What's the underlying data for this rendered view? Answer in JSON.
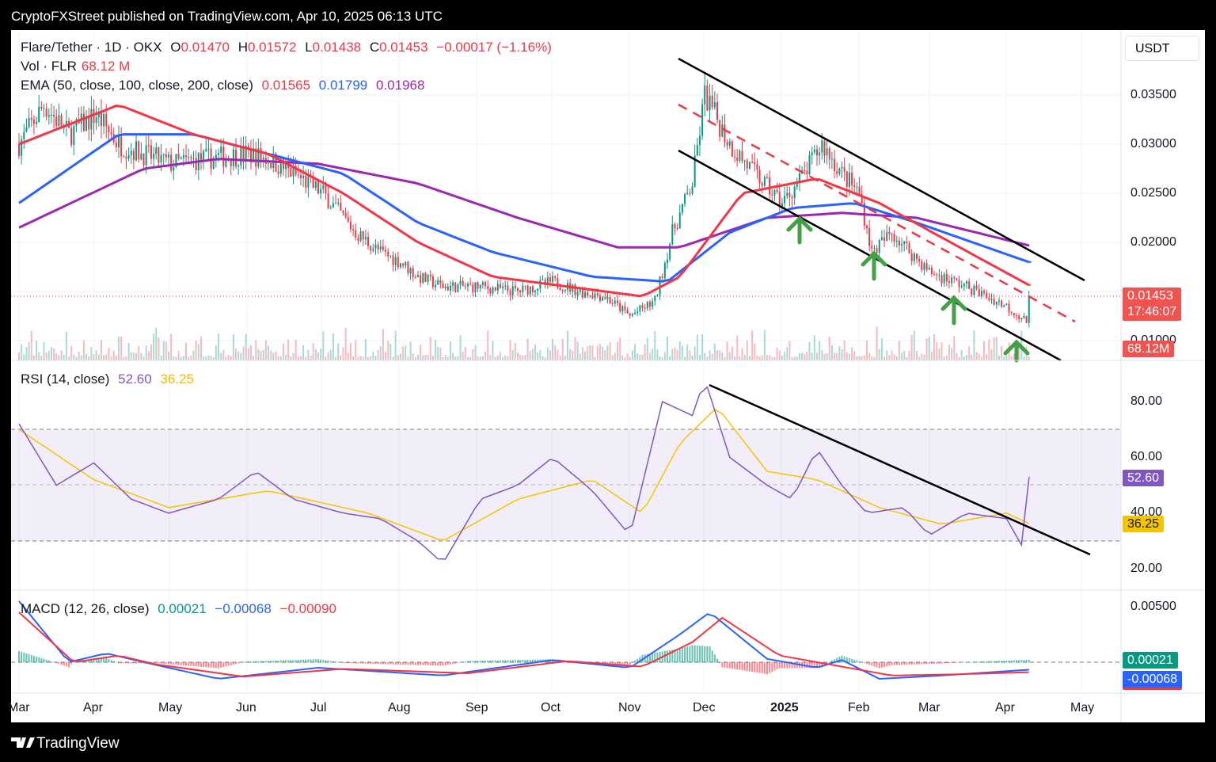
{
  "header": {
    "published": "CryptoFXStreet published on TradingView.com, Apr 10, 2025 06:13 UTC"
  },
  "footer": {
    "brand": "TradingView"
  },
  "legend": {
    "symbol": "Flare/Tether · 1D · OKX",
    "o_label": "O",
    "o": "0.01470",
    "h_label": "H",
    "h": "0.01572",
    "l_label": "L",
    "l": "0.01438",
    "c_label": "C",
    "c": "0.01453",
    "change": "−0.00017 (−1.16%)",
    "vol_label": "Vol · FLR",
    "vol": "68.12 M",
    "ema_label": "EMA (50, close, 100, close, 200, close)",
    "ema50": "0.01565",
    "ema100": "0.01799",
    "ema200": "0.01968",
    "rsi_label": "RSI (14, close)",
    "rsi": "52.60",
    "rsi_ma": "36.25",
    "macd_label": "MACD (12, 26, close)",
    "macd_hist": "0.00021",
    "macd": "−0.00068",
    "macd_signal": "−0.00090"
  },
  "axis": {
    "currency": "USDT",
    "price_ticks": [
      "0.03500",
      "0.03000",
      "0.02500",
      "0.02000",
      "0.01000"
    ],
    "rsi_ticks": [
      "80.00",
      "60.00",
      "40.00",
      "20.00"
    ],
    "macd_ticks": [
      "0.00500"
    ],
    "time_ticks": [
      "Mar",
      "Apr",
      "May",
      "Jun",
      "Jul",
      "Aug",
      "Sep",
      "Oct",
      "Nov",
      "Dec",
      "2025",
      "Feb",
      "Mar",
      "Apr",
      "May"
    ]
  },
  "tags": {
    "price": "0.01453",
    "countdown": "17:46:07",
    "volume": "68.12M",
    "rsi": "52.60",
    "rsi_ma": "36.25",
    "macd_hist": "0.00021",
    "macd": "-0.00068"
  },
  "colors": {
    "up": "#089981",
    "down": "#f23645",
    "ema50": "#f23645",
    "ema100": "#2962ff",
    "ema200": "#9c27b0",
    "rsi": "#7e57c2",
    "rsi_ma": "#f5c400",
    "arrow": "#43a047"
  },
  "chart_data": {
    "type": "line",
    "title": "Flare/Tether · 1D · OKX",
    "x_unit": "days since 2024-03-01",
    "close": [
      [
        0,
        0.03
      ],
      [
        10,
        0.034
      ],
      [
        20,
        0.031
      ],
      [
        31,
        0.033
      ],
      [
        40,
        0.03
      ],
      [
        50,
        0.029
      ],
      [
        61,
        0.028
      ],
      [
        75,
        0.0285
      ],
      [
        92,
        0.029
      ],
      [
        100,
        0.0285
      ],
      [
        110,
        0.027
      ],
      [
        122,
        0.025
      ],
      [
        135,
        0.021
      ],
      [
        145,
        0.019
      ],
      [
        153,
        0.018
      ],
      [
        160,
        0.0165
      ],
      [
        170,
        0.0155
      ],
      [
        184,
        0.0155
      ],
      [
        200,
        0.015
      ],
      [
        214,
        0.016
      ],
      [
        225,
        0.015
      ],
      [
        235,
        0.0145
      ],
      [
        245,
        0.0125
      ],
      [
        255,
        0.014
      ],
      [
        262,
        0.021
      ],
      [
        270,
        0.026
      ],
      [
        275,
        0.035
      ],
      [
        285,
        0.03
      ],
      [
        295,
        0.027
      ],
      [
        306,
        0.024
      ],
      [
        315,
        0.027
      ],
      [
        322,
        0.03
      ],
      [
        330,
        0.027
      ],
      [
        337,
        0.025
      ],
      [
        342,
        0.019
      ],
      [
        350,
        0.021
      ],
      [
        365,
        0.017
      ],
      [
        380,
        0.0155
      ],
      [
        396,
        0.0135
      ],
      [
        404,
        0.012
      ],
      [
        405,
        0.01453
      ]
    ],
    "ema50": [
      [
        0,
        0.03
      ],
      [
        40,
        0.034
      ],
      [
        70,
        0.031
      ],
      [
        100,
        0.029
      ],
      [
        130,
        0.025
      ],
      [
        160,
        0.02
      ],
      [
        190,
        0.0165
      ],
      [
        220,
        0.0155
      ],
      [
        250,
        0.0145
      ],
      [
        265,
        0.0165
      ],
      [
        290,
        0.025
      ],
      [
        320,
        0.0265
      ],
      [
        345,
        0.024
      ],
      [
        370,
        0.0205
      ],
      [
        405,
        0.01565
      ]
    ],
    "ema100": [
      [
        0,
        0.024
      ],
      [
        40,
        0.031
      ],
      [
        70,
        0.031
      ],
      [
        100,
        0.029
      ],
      [
        130,
        0.027
      ],
      [
        160,
        0.022
      ],
      [
        190,
        0.019
      ],
      [
        230,
        0.0165
      ],
      [
        260,
        0.016
      ],
      [
        285,
        0.021
      ],
      [
        310,
        0.0235
      ],
      [
        335,
        0.024
      ],
      [
        360,
        0.022
      ],
      [
        405,
        0.01799
      ]
    ],
    "ema200": [
      [
        0,
        0.0215
      ],
      [
        50,
        0.0275
      ],
      [
        80,
        0.0285
      ],
      [
        120,
        0.028
      ],
      [
        160,
        0.026
      ],
      [
        200,
        0.0225
      ],
      [
        240,
        0.0195
      ],
      [
        265,
        0.0195
      ],
      [
        300,
        0.0225
      ],
      [
        330,
        0.023
      ],
      [
        360,
        0.0225
      ],
      [
        405,
        0.01968
      ]
    ],
    "rsi": [
      [
        0,
        72
      ],
      [
        15,
        50
      ],
      [
        30,
        58
      ],
      [
        45,
        45
      ],
      [
        60,
        40
      ],
      [
        80,
        45
      ],
      [
        95,
        55
      ],
      [
        110,
        45
      ],
      [
        130,
        40
      ],
      [
        145,
        38
      ],
      [
        160,
        30
      ],
      [
        170,
        22
      ],
      [
        185,
        45
      ],
      [
        200,
        50
      ],
      [
        214,
        60
      ],
      [
        230,
        48
      ],
      [
        245,
        32
      ],
      [
        258,
        80
      ],
      [
        270,
        75
      ],
      [
        275,
        88
      ],
      [
        285,
        60
      ],
      [
        300,
        50
      ],
      [
        310,
        45
      ],
      [
        320,
        63
      ],
      [
        330,
        50
      ],
      [
        340,
        40
      ],
      [
        355,
        42
      ],
      [
        365,
        32
      ],
      [
        380,
        40
      ],
      [
        396,
        38
      ],
      [
        403,
        27
      ],
      [
        405,
        52.6
      ]
    ],
    "rsi_ma": [
      [
        0,
        70
      ],
      [
        30,
        52
      ],
      [
        60,
        42
      ],
      [
        100,
        48
      ],
      [
        140,
        40
      ],
      [
        170,
        30
      ],
      [
        200,
        45
      ],
      [
        230,
        52
      ],
      [
        250,
        40
      ],
      [
        265,
        65
      ],
      [
        280,
        78
      ],
      [
        300,
        55
      ],
      [
        320,
        52
      ],
      [
        345,
        42
      ],
      [
        370,
        36
      ],
      [
        396,
        40
      ],
      [
        405,
        36.25
      ]
    ],
    "macd": [
      [
        0,
        0.0055
      ],
      [
        20,
        0.0
      ],
      [
        35,
        0.0008
      ],
      [
        50,
        0.0
      ],
      [
        80,
        -0.0015
      ],
      [
        120,
        -0.0005
      ],
      [
        170,
        -0.0012
      ],
      [
        214,
        0.0002
      ],
      [
        245,
        -0.0005
      ],
      [
        265,
        0.0025
      ],
      [
        277,
        0.0045
      ],
      [
        300,
        0.0003
      ],
      [
        320,
        -0.0005
      ],
      [
        330,
        0.0002
      ],
      [
        345,
        -0.0015
      ],
      [
        370,
        -0.0012
      ],
      [
        405,
        -0.00068
      ]
    ],
    "macd_signal": [
      [
        0,
        0.0045
      ],
      [
        22,
        0.0
      ],
      [
        40,
        0.0006
      ],
      [
        55,
        -0.0002
      ],
      [
        90,
        -0.0013
      ],
      [
        130,
        -0.0006
      ],
      [
        180,
        -0.001
      ],
      [
        220,
        0.0001
      ],
      [
        250,
        -0.0004
      ],
      [
        270,
        0.0018
      ],
      [
        282,
        0.004
      ],
      [
        305,
        0.0006
      ],
      [
        325,
        -0.0002
      ],
      [
        350,
        -0.0012
      ],
      [
        375,
        -0.0011
      ],
      [
        405,
        -0.0009
      ]
    ],
    "price_range": [
      0.0095,
      0.0385
    ],
    "rsi_range": [
      15,
      92
    ],
    "rsi_bands": [
      30,
      50,
      70
    ]
  }
}
